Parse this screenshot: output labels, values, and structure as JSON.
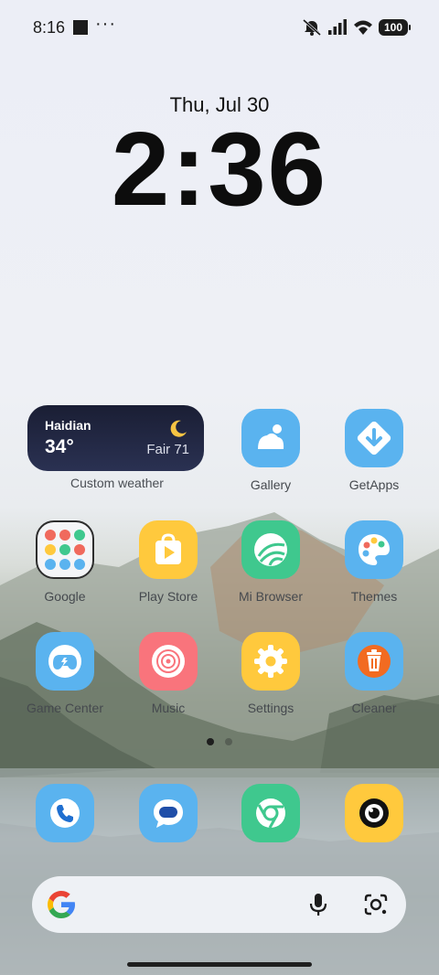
{
  "status_bar": {
    "time": "8:16",
    "battery": "100"
  },
  "lockscreen": {
    "date": "Thu, Jul 30",
    "time": "2:36"
  },
  "weather": {
    "city": "Haidian",
    "temp": "34°",
    "condition": "Fair 71",
    "label": "Custom weather"
  },
  "apps": [
    {
      "label": "Gallery",
      "icon": "gallery-icon",
      "color": "#5ab3ef"
    },
    {
      "label": "GetApps",
      "icon": "getapps-icon",
      "color": "#5ab3ef"
    },
    {
      "label": "Google",
      "icon": "google-folder-icon",
      "color": "#f4f5f7"
    },
    {
      "label": "Play Store",
      "icon": "play-store-icon",
      "color": "#ffc93d"
    },
    {
      "label": "Mi Browser",
      "icon": "mi-browser-icon",
      "color": "#3fc88e"
    },
    {
      "label": "Themes",
      "icon": "themes-icon",
      "color": "#5ab3ef"
    },
    {
      "label": "Game Center",
      "icon": "game-center-icon",
      "color": "#5ab3ef"
    },
    {
      "label": "Music",
      "icon": "music-icon",
      "color": "#f9747c"
    },
    {
      "label": "Settings",
      "icon": "settings-icon",
      "color": "#ffc93d"
    },
    {
      "label": "Cleaner",
      "icon": "cleaner-icon",
      "color": "#5ab3ef"
    }
  ],
  "dock": [
    {
      "icon": "phone-icon",
      "color": "#5ab3ef"
    },
    {
      "icon": "messages-icon",
      "color": "#5ab3ef"
    },
    {
      "icon": "chrome-icon",
      "color": "#3fc88e"
    },
    {
      "icon": "camera-icon",
      "color": "#ffc93d"
    }
  ],
  "search": {
    "placeholder": ""
  },
  "pages": {
    "current": 1,
    "total": 2
  }
}
